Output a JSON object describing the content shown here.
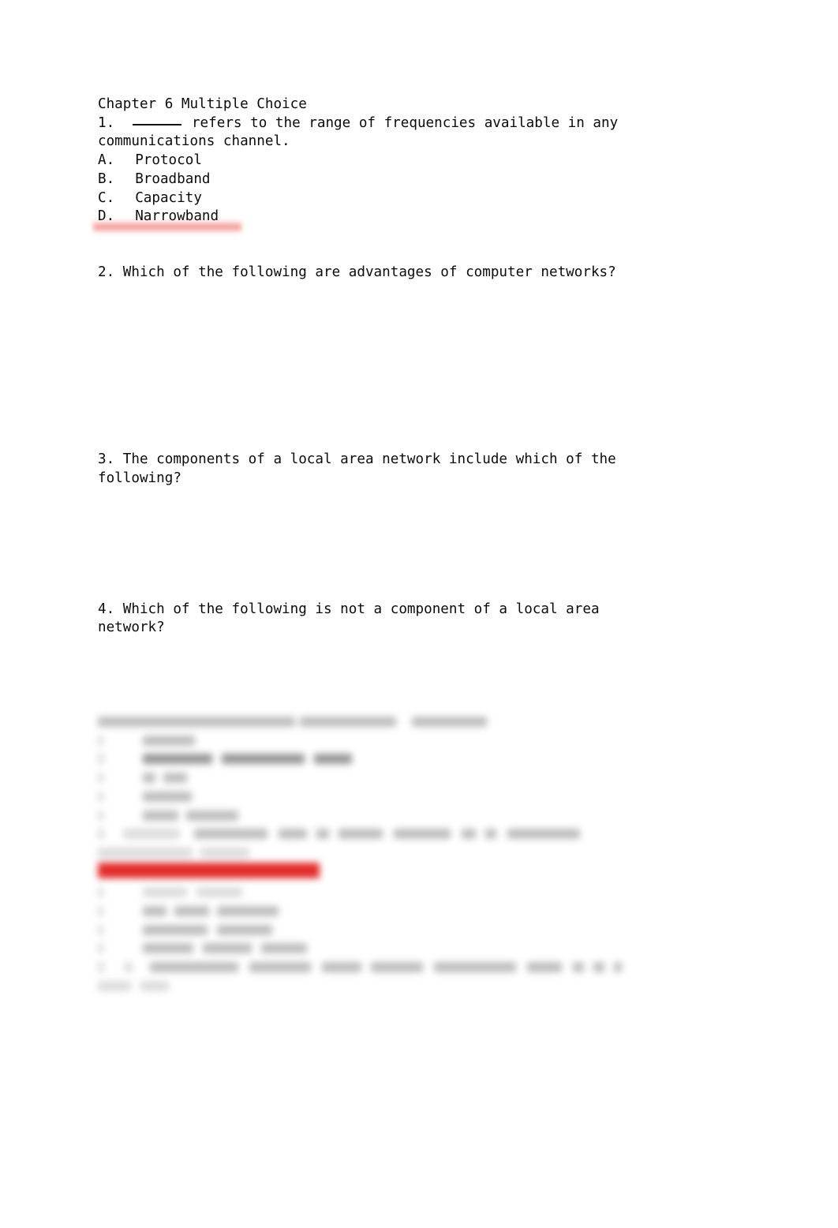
{
  "document": {
    "title": "Chapter 6 Multiple Choice",
    "page_background": "#ffffff",
    "text_color": "#0b0b0b",
    "highlight_color": "#e01b1b"
  },
  "content": {
    "heading": "Chapter 6 Multiple Choice",
    "q1": {
      "number": "1.",
      "text_before_blank": "1.  ",
      "text_after_blank": " refers to the range of frequencies available in any",
      "wrap_line": "communications channel.",
      "options": [
        {
          "letter": "A.",
          "label": "Protocol"
        },
        {
          "letter": "B.",
          "label": "Broadband"
        },
        {
          "letter": "C.",
          "label": "Capacity"
        },
        {
          "letter": "D.",
          "label": "Narrowband"
        }
      ],
      "answer_line": "obscured"
    },
    "q2": {
      "text": "2. Which of the following are advantages of computer networks?"
    },
    "q3": {
      "text_line_1": "3. The components of a local area network include which of the",
      "text_line_2": "following?"
    },
    "q4": {
      "text_line_1": "4. Which of the following is not a component of a local area",
      "text_line_2": "network?"
    },
    "obscured_block": {
      "status": "blurred",
      "note": "Lower portion of page is blurred and unreadable",
      "line_count": 14,
      "highlight_bars": 2
    }
  }
}
